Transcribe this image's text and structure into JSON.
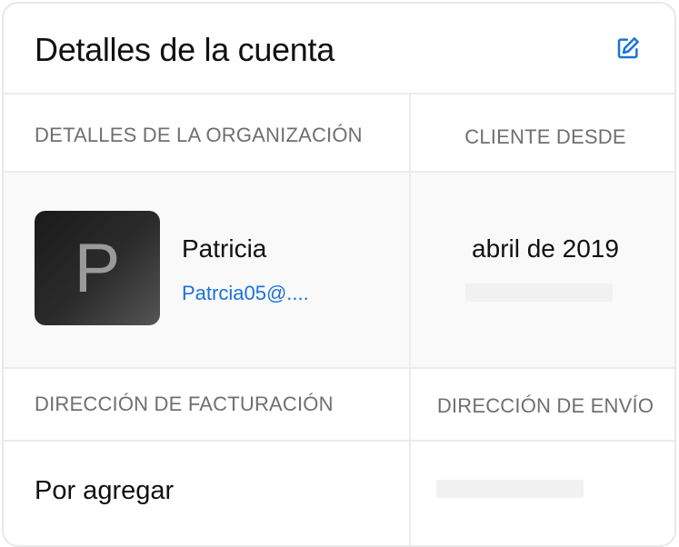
{
  "card": {
    "title": "Detalles de la cuenta",
    "edit_icon": "edit-icon"
  },
  "sections": {
    "organization_label": "DETALLES DE LA ORGANIZACIÓN",
    "customer_since_label": "CLIENTE DESDE",
    "billing_label": "DIRECCIÓN DE FACTURACIÓN",
    "shipping_label": "DIRECCIÓN DE ENVÍO"
  },
  "organization": {
    "avatar_letter": "P",
    "name": "Patricia",
    "email": "Patrcia05@...."
  },
  "customer_since": "abril de 2019",
  "billing_address": "Por agregar",
  "colors": {
    "accent": "#1a73d9",
    "label": "#6f6f6f",
    "divider": "#ececec"
  }
}
